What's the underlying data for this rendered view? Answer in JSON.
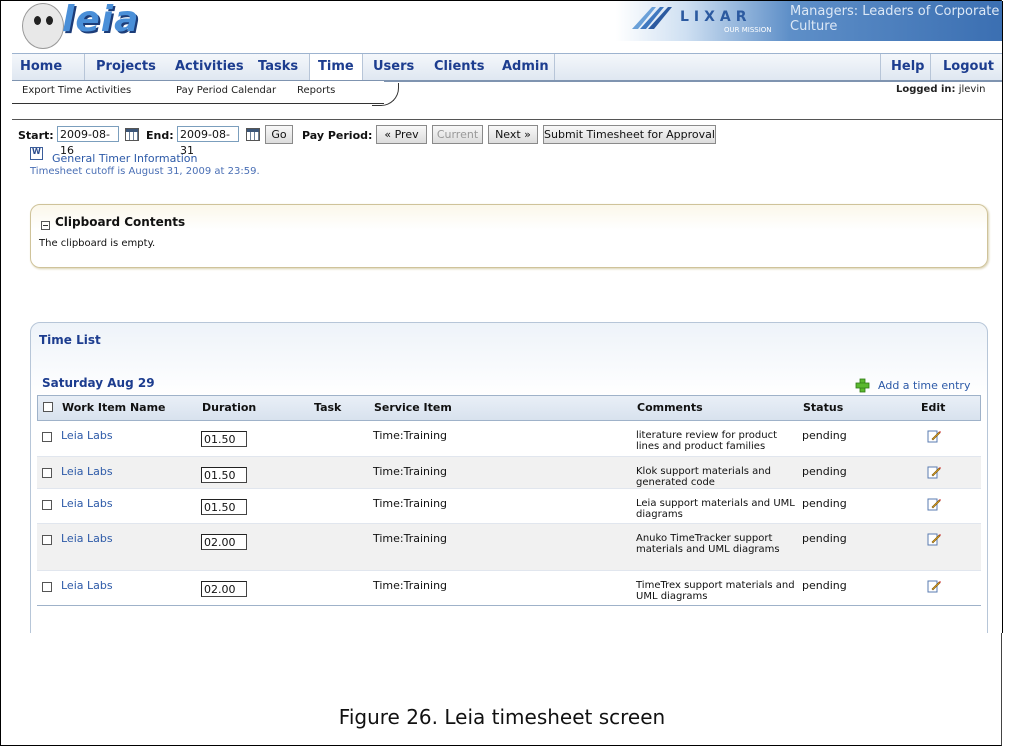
{
  "header": {
    "logo_text": "leia",
    "partner_name": "LIXAR",
    "partner_sub": "OUR MISSION",
    "tagline": "Managers: Leaders of Corporate Culture"
  },
  "nav": {
    "items": [
      "Home",
      "Projects",
      "Activities",
      "Tasks",
      "Time",
      "Users",
      "Clients",
      "Admin"
    ],
    "active": "Time",
    "right_items": [
      "Help",
      "Logout"
    ]
  },
  "subnav": {
    "items": [
      "Export Time Activities",
      "Pay Period Calendar",
      "Reports"
    ],
    "logged_label": "Logged in:",
    "logged_user": "jlevin"
  },
  "toolbar": {
    "start_label": "Start:",
    "start_value": "2009-08-16",
    "end_label": "End:",
    "end_value": "2009-08-31",
    "go_label": "Go",
    "pay_period_label": "Pay Period:",
    "prev_label": "« Prev",
    "current_label": "Current",
    "next_label": "Next »",
    "submit_label": "Submit Timesheet for Approval"
  },
  "links": {
    "general_timer": "General Timer Information",
    "cutoff": "Timesheet cutoff is August 31, 2009 at 23:59."
  },
  "clipboard": {
    "title": "Clipboard Contents",
    "empty_text": "The clipboard is empty."
  },
  "time_list": {
    "title": "Time List",
    "day": "Saturday Aug 29",
    "add_label": "Add a time entry",
    "columns": [
      "Work Item Name",
      "Duration",
      "Task",
      "Service Item",
      "Comments",
      "Status",
      "Edit"
    ],
    "rows": [
      {
        "work_item": "Leia Labs",
        "duration": "01.50",
        "task": "",
        "service_item": "Time:Training",
        "comments": "literature review for product lines and product families",
        "status": "pending"
      },
      {
        "work_item": "Leia Labs",
        "duration": "01.50",
        "task": "",
        "service_item": "Time:Training",
        "comments": "Klok support materials and generated code",
        "status": "pending"
      },
      {
        "work_item": "Leia Labs",
        "duration": "01.50",
        "task": "",
        "service_item": "Time:Training",
        "comments": "Leia support materials and UML diagrams",
        "status": "pending"
      },
      {
        "work_item": "Leia Labs",
        "duration": "02.00",
        "task": "",
        "service_item": "Time:Training",
        "comments": "Anuko TimeTracker support materials and UML diagrams",
        "status": "pending"
      },
      {
        "work_item": "Leia Labs",
        "duration": "02.00",
        "task": "",
        "service_item": "Time:Training",
        "comments": "TimeTrex support materials and UML diagrams",
        "status": "pending"
      }
    ]
  },
  "caption": "Figure 26. Leia timesheet screen",
  "icons": {
    "calendar": "calendar-icon",
    "doc": "word-doc-icon",
    "add": "plus-icon",
    "edit": "edit-pencil-icon",
    "collapse": "collapse-minus-icon"
  }
}
